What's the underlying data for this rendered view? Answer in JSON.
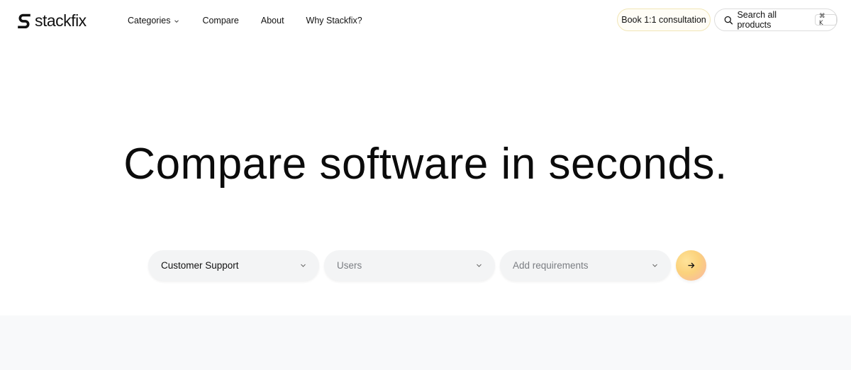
{
  "brand": {
    "name": "stackfix",
    "logo_icon": "stackfix-logo-icon"
  },
  "nav": {
    "categories": "Categories",
    "compare": "Compare",
    "about": "About",
    "why": "Why Stackfix?"
  },
  "header": {
    "book_label": "Book 1:1 consultation",
    "search_label": "Search all products",
    "search_shortcut": "⌘ K"
  },
  "hero": {
    "title": "Compare software in seconds."
  },
  "filters": {
    "category_value": "Customer Support",
    "users_placeholder": "Users",
    "requirements_placeholder": "Add requirements",
    "submit_icon": "arrow-right-icon"
  },
  "colors": {
    "book_border": "#f1e6b7",
    "filter_bg": "#f3f4f5",
    "go_gradient_start": "#ffe39a",
    "go_gradient_end": "#f8b5a6",
    "bottom_band": "#f8f9fa"
  }
}
